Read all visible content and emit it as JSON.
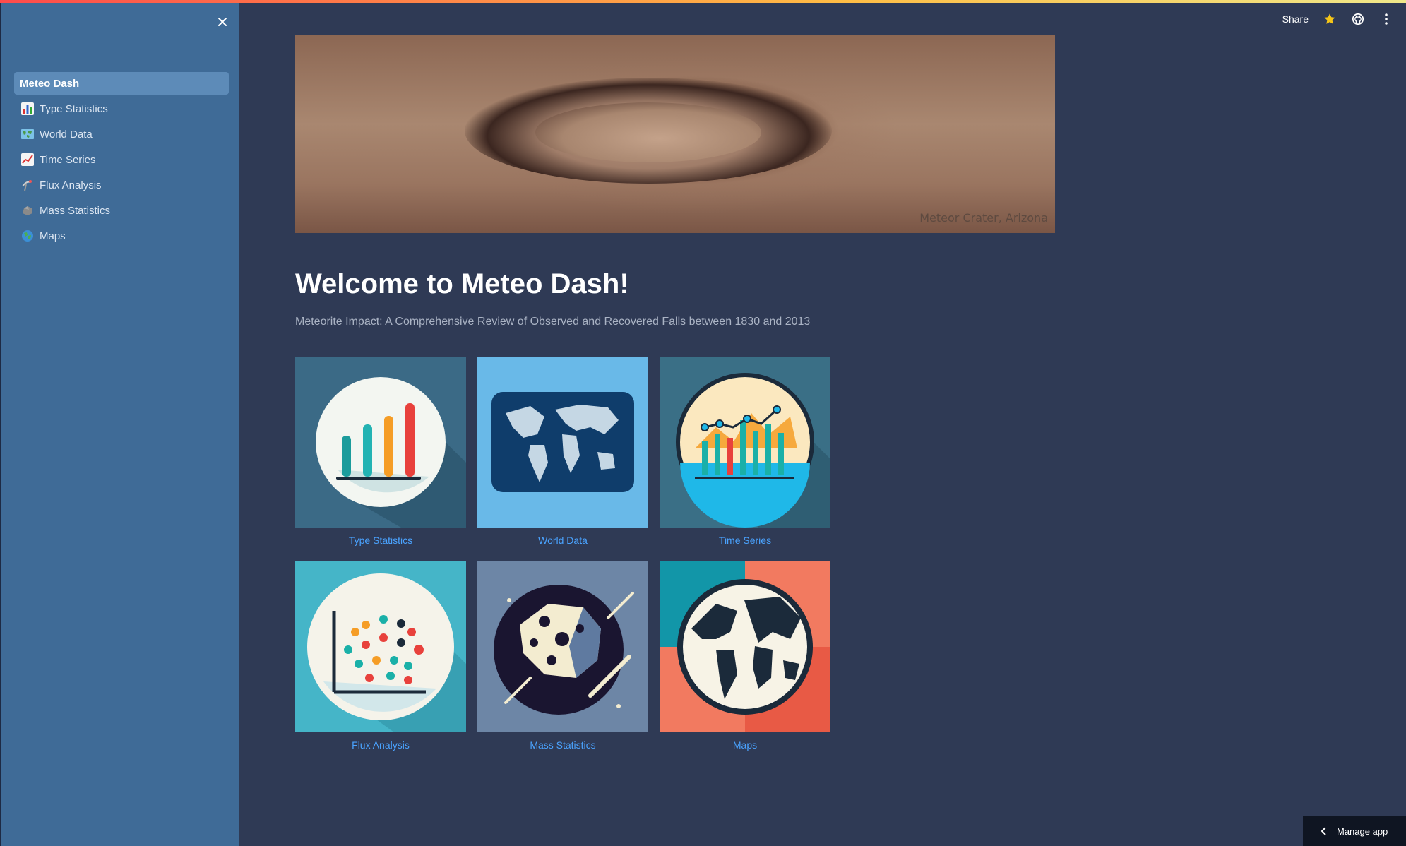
{
  "sidebar": {
    "items": [
      {
        "label": "Meteo Dash",
        "icon": "",
        "active": true
      },
      {
        "label": "Type Statistics",
        "icon": "bar-chart-icon"
      },
      {
        "label": "World Data",
        "icon": "map-icon"
      },
      {
        "label": "Time Series",
        "icon": "trend-chart-icon"
      },
      {
        "label": "Flux Analysis",
        "icon": "satellite-antenna-icon"
      },
      {
        "label": "Mass Statistics",
        "icon": "rock-icon"
      },
      {
        "label": "Maps",
        "icon": "globe-icon"
      }
    ]
  },
  "header": {
    "share_label": "Share"
  },
  "hero": {
    "caption": "Meteor Crater, Arizona"
  },
  "main": {
    "title": "Welcome to Meteo Dash!",
    "subtitle": "Meteorite Impact: A Comprehensive Review of Observed and Recovered Falls between 1830 and 2013"
  },
  "cards": [
    {
      "label": "Type Statistics"
    },
    {
      "label": "World Data"
    },
    {
      "label": "Time Series"
    },
    {
      "label": "Flux Analysis"
    },
    {
      "label": "Mass Statistics"
    },
    {
      "label": "Maps"
    }
  ],
  "footer": {
    "manage_label": "Manage app"
  },
  "colors": {
    "background": "#2f3a55",
    "sidebar": "#3f6b97",
    "link": "#4aa3ff"
  }
}
